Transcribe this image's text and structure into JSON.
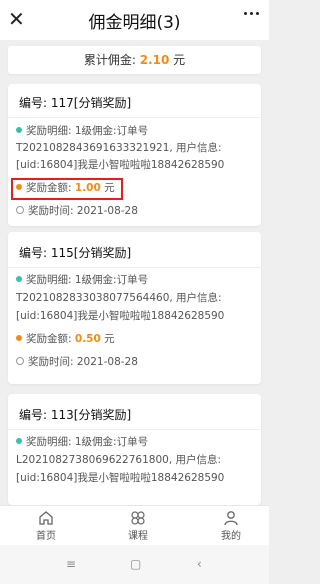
{
  "header": {
    "title": "佣金明细(3)",
    "back_icon": "close-icon"
  },
  "summary": {
    "label": "累计佣金:",
    "amount": "2.10",
    "unit": "元"
  },
  "cards": [
    {
      "no": "编号: 117[分销奖励]",
      "detail_label": "奖励明细: 1级佣金:订单号",
      "detail_line2": "T2021082843691633321921, 用户信息:",
      "detail_line3": "[uid:16804]我是小智啦啦啦18842628590",
      "amount_label": "奖励金额: ",
      "amount_value": "1.00",
      "amount_unit": "元",
      "time_label": "奖励时间: 2021-08-28"
    },
    {
      "no": "编号: 115[分销奖励]",
      "detail_label": "奖励明细: 1级佣金:订单号",
      "detail_line2": "T2021082833038077564460, 用户信息:",
      "detail_line3": "[uid:16804]我是小智啦啦啦18842628590",
      "amount_label": "奖励金额: ",
      "amount_value": "0.50",
      "amount_unit": "元",
      "time_label": "奖励时间: 2021-08-28"
    },
    {
      "no": "编号: 113[分销奖励]",
      "detail_label": "奖励明细: 1级佣金:订单号",
      "detail_line2": "L2021082738069622761800, 用户信息:",
      "detail_line3": "[uid:16804]我是小智啦啦啦18842628590"
    }
  ],
  "tabs": [
    {
      "label": "首页",
      "icon": "home-icon"
    },
    {
      "label": "课程",
      "icon": "clover-icon"
    },
    {
      "label": "我的",
      "icon": "user-icon"
    }
  ],
  "system_nav": {
    "menu": "≡",
    "home": "▢",
    "back": "‹"
  },
  "colors": {
    "accent": "#f28c16",
    "dot_green": "#36c2a4",
    "highlight": "#e02020"
  }
}
